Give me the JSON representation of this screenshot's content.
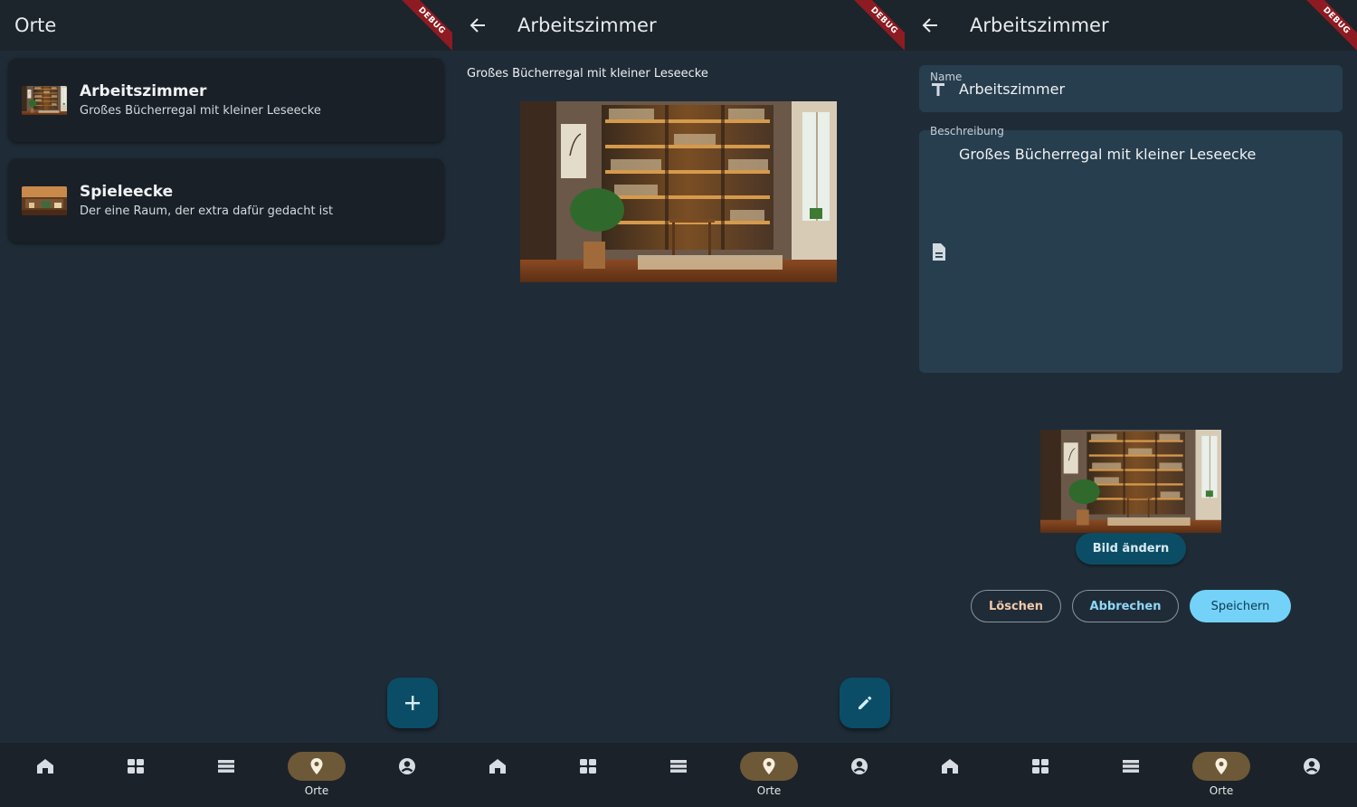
{
  "colors": {
    "background": "#1f2c37",
    "appbar": "#1c242c",
    "card": "#192027",
    "fab": "#0b4d66",
    "nav_active_pill": "#6d5937",
    "field": "#273e4f",
    "save_button": "#74d2f8",
    "debug_ribbon": "#8e1b21"
  },
  "debug_banner": "DEBUG",
  "list_screen": {
    "title": "Orte",
    "items": [
      {
        "title": "Arbeitszimmer",
        "subtitle": "Großes Bücherregal mit kleiner Leseecke",
        "icon": "bookshelf-thumbnail"
      },
      {
        "title": "Spieleecke",
        "subtitle": "Der eine Raum, der extra dafür gedacht ist",
        "icon": "game-room-thumbnail"
      }
    ],
    "fab_icon": "plus-icon"
  },
  "detail_screen": {
    "title": "Arbeitszimmer",
    "description": "Großes Bücherregal mit kleiner Leseecke",
    "image": "bookshelf-room-image",
    "fab_icon": "pencil-icon"
  },
  "edit_screen": {
    "title": "Arbeitszimmer",
    "name_label": "Name",
    "name_value": "Arbeitszimmer",
    "description_label": "Beschreibung",
    "description_value": "Großes Bücherregal mit kleiner Leseecke",
    "change_image_label": "Bild ändern",
    "delete_label": "Löschen",
    "cancel_label": "Abbrechen",
    "save_label": "Speichern"
  },
  "bottom_nav": {
    "items": [
      {
        "icon": "home-icon",
        "label": ""
      },
      {
        "icon": "dashboard-icon",
        "label": ""
      },
      {
        "icon": "list-icon",
        "label": ""
      },
      {
        "icon": "location-pin-icon",
        "label": "Orte",
        "active": true
      },
      {
        "icon": "account-icon",
        "label": ""
      }
    ]
  }
}
